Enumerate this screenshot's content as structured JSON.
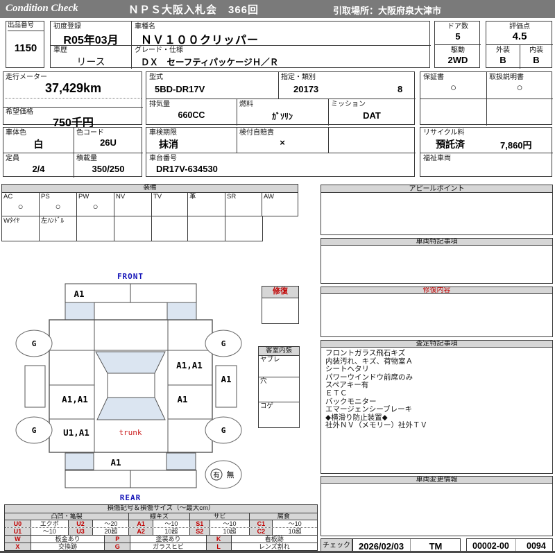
{
  "colors": {
    "header_bg": "#7a7a7a",
    "accent_red": "#c00000",
    "accent_blue": "#1414b8",
    "glass": "#dbe5f1",
    "bar_bg": "#d6d6d6"
  },
  "header": {
    "brand": "Condition  Check",
    "title": "ＮＰＳ大阪入札会　366回",
    "pickup": "引取場所：大阪府泉大津市"
  },
  "info": {
    "lot_label": "出品番号",
    "lot": "1150",
    "first_reg_label": "初度登録",
    "first_reg": "R05年03月",
    "history_label": "車歴",
    "history": "リース",
    "model_name_label": "車種名",
    "model_name": "ＮＶ１００クリッパー",
    "grade_label": "グレード・仕様",
    "grade": "ＤＸ　セーフティパッケージＨ／Ｒ",
    "doors_label": "ドア数",
    "doors": "5",
    "drive_label": "駆動",
    "drive": "2WD",
    "score_label": "評価点",
    "score": "4.5",
    "exterior_label": "外装",
    "exterior": "B",
    "interior_label": "内装",
    "interior": "B",
    "odo_label": "走行メーター",
    "odo": "37,429km",
    "price_label": "希望価格",
    "price": "750千円",
    "type_label": "型式",
    "type": "5BD-DR17V",
    "class_label": "指定・類別",
    "class1": "20173",
    "class2": "8",
    "disp_label": "排気量",
    "disp": "660CC",
    "fuel_label": "燃料",
    "fuel": "ｶﾞｿﾘﾝ",
    "mission_label": "ミッション",
    "mission": "DAT",
    "warranty_label": "保証書",
    "warranty": "○",
    "manual_label": "取扱説明書",
    "manual": "○",
    "color_label": "車体色",
    "color": "白",
    "color_code_label": "色コード",
    "color_code": "26U",
    "inspection_label": "車検期限",
    "inspection": "抹消",
    "insurance_label": "検付自賠責",
    "insurance": "×",
    "capacity_label": "定員",
    "capacity": "2/4",
    "load_label": "積載量",
    "load": "350/250",
    "vin_label": "車台番号",
    "vin": "DR17V-634530",
    "recycle_label": "リサイクル料",
    "recycle_status": "預託済",
    "recycle_fee": "7,860円",
    "welfare_label": "福祉車両"
  },
  "equipment": {
    "title": "装備",
    "cols": [
      {
        "label": "AC",
        "mark": "○"
      },
      {
        "label": "PS",
        "mark": "○"
      },
      {
        "label": "PW",
        "mark": "○"
      },
      {
        "label": "NV",
        "mark": ""
      },
      {
        "label": "TV",
        "mark": ""
      },
      {
        "label": "革",
        "mark": ""
      },
      {
        "label": "SR",
        "mark": ""
      },
      {
        "label": "AW",
        "mark": ""
      }
    ],
    "extra": [
      "Wﾀｲﾔ",
      "左ﾊﾝﾄﾞﾙ",
      "",
      "",
      "",
      "",
      ""
    ]
  },
  "panels": {
    "appeal_title": "アピールポイント",
    "notes_title": "車両特記事項",
    "repair_title": "修復内容",
    "assessment_title": "査定特記事項",
    "assessment_items": [
      "フロントガラス飛石キズ",
      "内装汚れ、キズ、荷物室Ａ",
      "シートヘタリ",
      "パワーウインドウ前席のみ",
      "スペアキー有",
      "ＥＴＣ",
      "バックモニター",
      "エマージェンシーブレーキ",
      "◆横滑り防止装置◆",
      "社外ＮＶ（メモリー）社外ＴＶ"
    ],
    "change_title": "車両変更情報"
  },
  "diagram": {
    "front": "FRONT",
    "rear": "REAR",
    "trunk": "trunk",
    "wheel": "G",
    "repair_label": "修復",
    "cabin_title": "客室内張",
    "cabin_rows": [
      "ヤブレ",
      "穴",
      "コゲ"
    ],
    "flag_yes": "有",
    "flag_no": "無",
    "marks": {
      "front_bumper": "A1",
      "right_front": "A1,A1",
      "right_side": "A1",
      "left_door": "A1,A1",
      "right_rear": "A1",
      "left_quarter": "U1,A1",
      "rear_bumper": "A1"
    }
  },
  "legend": {
    "title": "損傷記号＆損傷サイズ（～最大cm）",
    "groups": [
      "凸凹・亀裂",
      "線キズ",
      "サビ",
      "腐食"
    ],
    "row1": [
      {
        "c": "U0",
        "v": "エクボ"
      },
      {
        "c": "U2",
        "v": "～20"
      },
      {
        "c": "A1",
        "v": "～10"
      },
      {
        "c": "S1",
        "v": "～10"
      },
      {
        "c": "C1",
        "v": "～10"
      }
    ],
    "row2": [
      {
        "c": "U1",
        "v": "～10"
      },
      {
        "c": "U3",
        "v": "20超"
      },
      {
        "c": "A2",
        "v": "10超"
      },
      {
        "c": "S2",
        "v": "10超"
      },
      {
        "c": "C2",
        "v": "10超"
      }
    ],
    "row3": [
      {
        "c": "W",
        "v": "板金あり"
      },
      {
        "c": "P",
        "v": "塗装あり"
      },
      {
        "c": "K",
        "v": "看板跡"
      }
    ],
    "row4": [
      {
        "c": "X",
        "v": "交換跡"
      },
      {
        "c": "G",
        "v": "ガラスヒビ"
      },
      {
        "c": "L",
        "v": "レンズ割れ"
      }
    ]
  },
  "footer": {
    "check_label": "チェック",
    "date": "2026/02/03",
    "inspector": "TM",
    "code1": "00002-00",
    "code2": "0094"
  }
}
